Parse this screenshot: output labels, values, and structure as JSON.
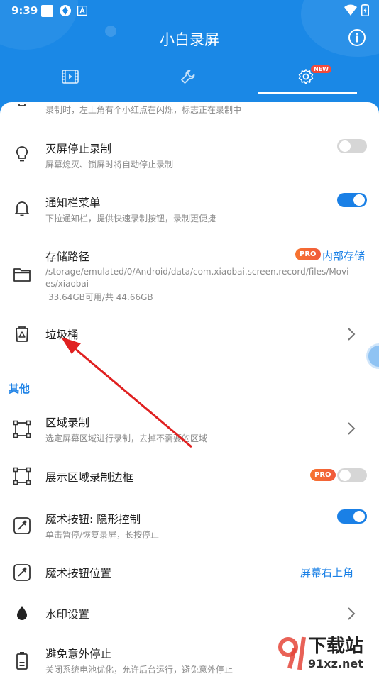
{
  "status_bar": {
    "time": "9:39",
    "icons": [
      "image-icon",
      "aperture-icon",
      "a-box-icon"
    ],
    "right_icons": [
      "wifi-icon",
      "battery-icon"
    ]
  },
  "header": {
    "title": "小白录屏",
    "info_icon": "info-icon",
    "tabs": [
      {
        "icon": "video-film-icon",
        "selected": false
      },
      {
        "icon": "wrench-icon",
        "selected": false
      },
      {
        "icon": "gear-icon",
        "selected": true,
        "badge": "NEW"
      }
    ]
  },
  "settings": {
    "top_partial_sub": "录制时，左上角有个小红点在闪烁，标志正在录制中",
    "screen_off": {
      "title": "灭屏停止录制",
      "sub": "屏幕熄灭、锁屏时将自动停止录制",
      "toggle": "off"
    },
    "notification": {
      "title": "通知栏菜单",
      "sub": "下拉通知栏，提供快速录制按钮，录制更便捷",
      "toggle": "on"
    },
    "storage": {
      "title": "存储路径",
      "badge": "PRO",
      "value": "内部存储",
      "path": "/storage/emulated/0/Android/data/com.xiaobai.screen.record/files/Movies/xiaobai",
      "space": "33.64GB可用/共 44.66GB"
    },
    "trash": {
      "title": "垃圾桶"
    }
  },
  "others": {
    "section_label": "其他",
    "region_record": {
      "title": "区域录制",
      "sub": "选定屏幕区域进行录制，去掉不需要的区域"
    },
    "region_border": {
      "title": "展示区域录制边框",
      "badge": "PRO",
      "toggle": "off"
    },
    "magic_button": {
      "title": "魔术按钮: 隐形控制",
      "sub": "单击暂停/恢复录屏，长按停止",
      "toggle": "on"
    },
    "magic_position": {
      "title": "魔术按钮位置",
      "value": "屏幕右上角"
    },
    "watermark": {
      "title": "水印设置"
    },
    "avoid_stop": {
      "title": "避免意外停止",
      "sub": "关闭系统电池优化，允许后台运行，避免意外停止"
    }
  },
  "overlay_watermark": {
    "main": "下载站",
    "url": "91xz.net"
  },
  "colors": {
    "primary": "#1a88e6",
    "accent": "#1a80e6",
    "pro": "#f05a3c",
    "arrow": "#e02020"
  }
}
